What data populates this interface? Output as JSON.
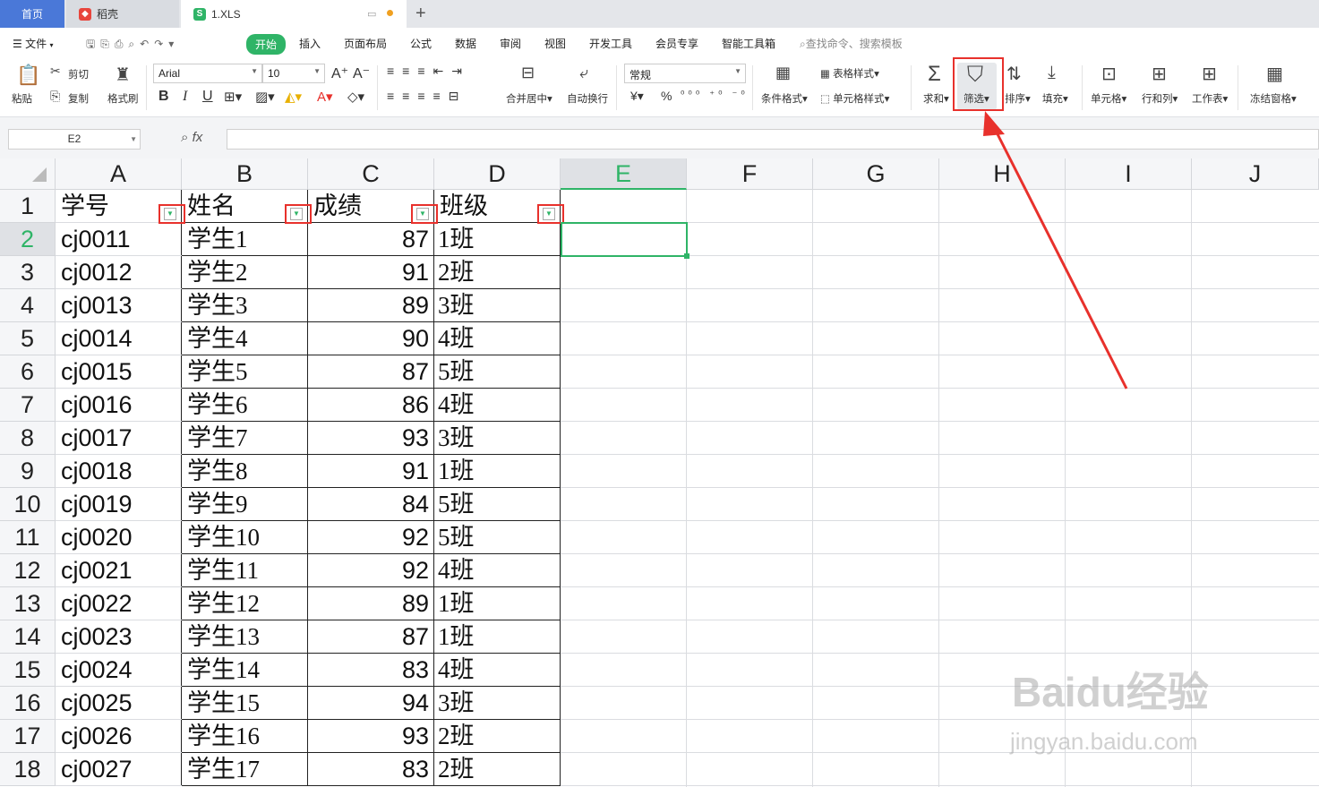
{
  "tabs": {
    "home": "首页",
    "daoke": "稻壳",
    "file": "1.XLS",
    "add": "+"
  },
  "menu": {
    "file": "文件",
    "start": "开始",
    "insert": "插入",
    "layout": "页面布局",
    "formula": "公式",
    "data": "数据",
    "review": "审阅",
    "view": "视图",
    "dev": "开发工具",
    "member": "会员专享",
    "smart": "智能工具箱",
    "search": "查找命令、搜索模板"
  },
  "ribbon": {
    "paste": "粘贴",
    "cut": "剪切",
    "copy": "复制",
    "format_painter": "格式刷",
    "font_name": "Arial",
    "font_size": "10",
    "bold": "B",
    "italic": "I",
    "underline": "U",
    "merge_center": "合并居中",
    "wrap": "自动换行",
    "number_format": "常规",
    "currency": "¥",
    "percent": "%",
    "cond_format": "条件格式",
    "table_style": "表格样式",
    "cell_style": "单元格样式",
    "sum": "求和",
    "filter": "筛选",
    "sort": "排序",
    "fill": "填充",
    "cell": "单元格",
    "rowcol": "行和列",
    "sheet": "工作表",
    "freeze": "冻结窗格"
  },
  "namebox": "E2",
  "fx": "fx",
  "columns": [
    "A",
    "B",
    "C",
    "D",
    "E",
    "F",
    "G",
    "H",
    "I",
    "J"
  ],
  "header_row": [
    "学号",
    "姓名",
    "成绩",
    "班级"
  ],
  "rows": [
    {
      "n": "2",
      "id": "cj0011",
      "name": "学生1",
      "score": "87",
      "cls": "1班"
    },
    {
      "n": "3",
      "id": "cj0012",
      "name": "学生2",
      "score": "91",
      "cls": "2班"
    },
    {
      "n": "4",
      "id": "cj0013",
      "name": "学生3",
      "score": "89",
      "cls": "3班"
    },
    {
      "n": "5",
      "id": "cj0014",
      "name": "学生4",
      "score": "90",
      "cls": "4班"
    },
    {
      "n": "6",
      "id": "cj0015",
      "name": "学生5",
      "score": "87",
      "cls": "5班"
    },
    {
      "n": "7",
      "id": "cj0016",
      "name": "学生6",
      "score": "86",
      "cls": "4班"
    },
    {
      "n": "8",
      "id": "cj0017",
      "name": "学生7",
      "score": "93",
      "cls": "3班"
    },
    {
      "n": "9",
      "id": "cj0018",
      "name": "学生8",
      "score": "91",
      "cls": "1班"
    },
    {
      "n": "10",
      "id": "cj0019",
      "name": "学生9",
      "score": "84",
      "cls": "5班"
    },
    {
      "n": "11",
      "id": "cj0020",
      "name": "学生10",
      "score": "92",
      "cls": "5班"
    },
    {
      "n": "12",
      "id": "cj0021",
      "name": "学生11",
      "score": "92",
      "cls": "4班"
    },
    {
      "n": "13",
      "id": "cj0022",
      "name": "学生12",
      "score": "89",
      "cls": "1班"
    },
    {
      "n": "14",
      "id": "cj0023",
      "name": "学生13",
      "score": "87",
      "cls": "1班"
    },
    {
      "n": "15",
      "id": "cj0024",
      "name": "学生14",
      "score": "83",
      "cls": "4班"
    },
    {
      "n": "16",
      "id": "cj0025",
      "name": "学生15",
      "score": "94",
      "cls": "3班"
    },
    {
      "n": "17",
      "id": "cj0026",
      "name": "学生16",
      "score": "93",
      "cls": "2班"
    },
    {
      "n": "18",
      "id": "cj0027",
      "name": "学生17",
      "score": "83",
      "cls": "2班"
    }
  ],
  "watermark": "Baidu经验 jingyan.baidu.com",
  "colors": {
    "accent": "#2fb467",
    "annotation": "#e8312c",
    "home_tab": "#4a78d8"
  }
}
